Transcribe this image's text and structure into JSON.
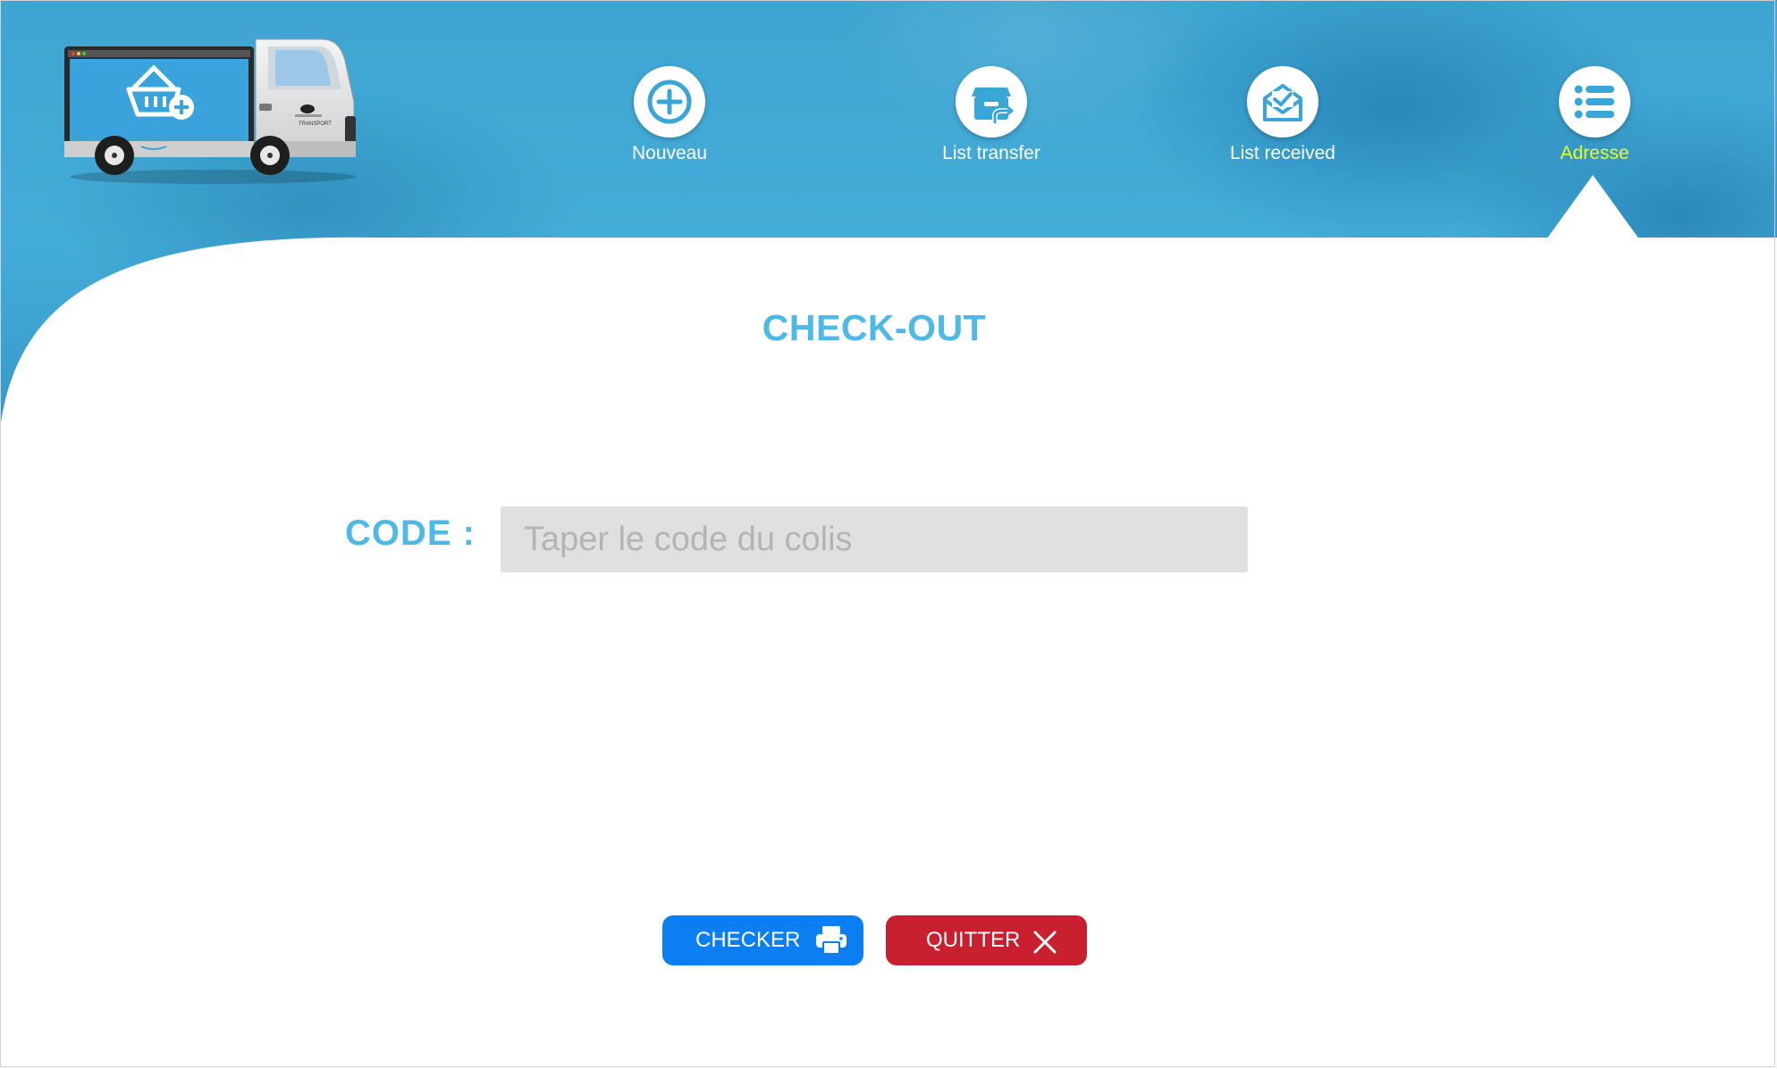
{
  "nav": {
    "items": [
      {
        "label": "Nouveau",
        "icon": "plus-circle-icon"
      },
      {
        "label": "List transfer",
        "icon": "box-transfer-icon"
      },
      {
        "label": "List received",
        "icon": "mail-check-icon"
      },
      {
        "label": "Adresse",
        "icon": "list-icon",
        "active": true
      }
    ]
  },
  "logo": {
    "truck_text": "TRANSPORT",
    "icon": "delivery-truck-basket-icon"
  },
  "page": {
    "title": "CHECK-OUT"
  },
  "form": {
    "code_label": "CODE :",
    "code_placeholder": "Taper le code du colis",
    "code_value": ""
  },
  "buttons": {
    "checker_label": "CHECKER",
    "checker_icon": "printer-icon",
    "quitter_label": "QUITTER",
    "quitter_icon": "close-icon"
  },
  "colors": {
    "header_blue": "#44acd8",
    "title_blue": "#4eb9e6",
    "active_nav": "#e8ff1a",
    "checker_bg": "#0b7ff2",
    "quitter_bg": "#c8202f",
    "input_bg": "#e0e0e0"
  }
}
